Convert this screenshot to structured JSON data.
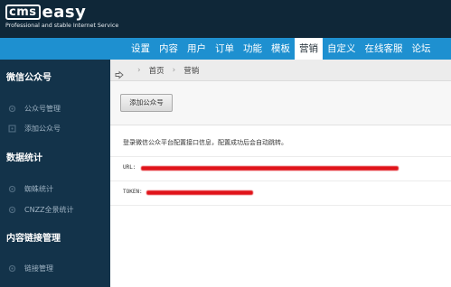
{
  "header": {
    "logo_box_text": "cms",
    "logo_word": "easy",
    "tagline": "Professional and stable Internet Service"
  },
  "nav": {
    "items": [
      {
        "label": "设置"
      },
      {
        "label": "内容"
      },
      {
        "label": "用户"
      },
      {
        "label": "订单"
      },
      {
        "label": "功能"
      },
      {
        "label": "模板"
      },
      {
        "label": "营销",
        "active": true
      },
      {
        "label": "自定义"
      },
      {
        "label": "在线客服"
      },
      {
        "label": "论坛"
      }
    ]
  },
  "sidebar": {
    "sections": [
      {
        "title": "微信公众号",
        "items": [
          {
            "label": "公众号管理",
            "icon": "gear-icon"
          },
          {
            "label": "添加公众号",
            "icon": "gear-icon"
          }
        ]
      },
      {
        "title": "数据统计",
        "items": [
          {
            "label": "蜘蛛统计",
            "icon": "gear-icon"
          },
          {
            "label": "CNZZ全景统计",
            "icon": "gear-icon"
          }
        ]
      },
      {
        "title": "内容链接管理",
        "items": [
          {
            "label": "链接管理",
            "icon": "gear-icon"
          }
        ]
      }
    ]
  },
  "breadcrumb": {
    "home": "首页",
    "current": "营销"
  },
  "main": {
    "add_button": "添加公众号",
    "info": "登录微信公众平台配置接口信息，配置成功后会自动跳转。",
    "url_label": "URL:",
    "token_label": "TOKEN:"
  },
  "colors": {
    "header_bg": "#0f2738",
    "nav_bg": "#1e90d0",
    "sidebar_bg": "#13334a",
    "redaction": "#e0141a"
  }
}
